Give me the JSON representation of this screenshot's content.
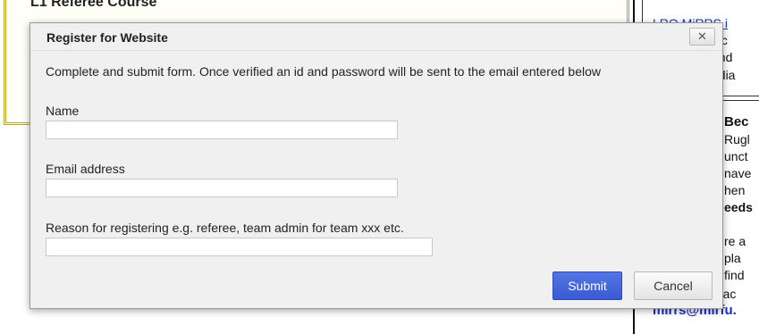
{
  "background": {
    "course_title": "L1 Referee Course",
    "right_column": {
      "line1": "LRO  MiRRS i",
      "line2": "loc",
      "line3": "and",
      "line4": "ndia",
      "heading1": "Bec",
      "line5": "Rugl",
      "line6": "unct",
      "line7": "nave",
      "line8": "hen",
      "heading2": "eeds",
      "line9": "re a",
      "line10": "pla",
      "line11": "find",
      "line12": "referee, contac",
      "email": "mirrs@mirfu."
    }
  },
  "dialog": {
    "title": "Register for Website",
    "close_label": "✕",
    "instructions": "Complete and submit form. Once verified an id and password will be sent to the email entered below",
    "fields": [
      {
        "label": "Name",
        "value": "",
        "placeholder": ""
      },
      {
        "label": "Email address",
        "value": "",
        "placeholder": ""
      },
      {
        "label": "Reason for registering e.g. referee, team admin for team xxx etc.",
        "value": "",
        "placeholder": ""
      }
    ],
    "submit_label": "Submit",
    "cancel_label": "Cancel"
  }
}
